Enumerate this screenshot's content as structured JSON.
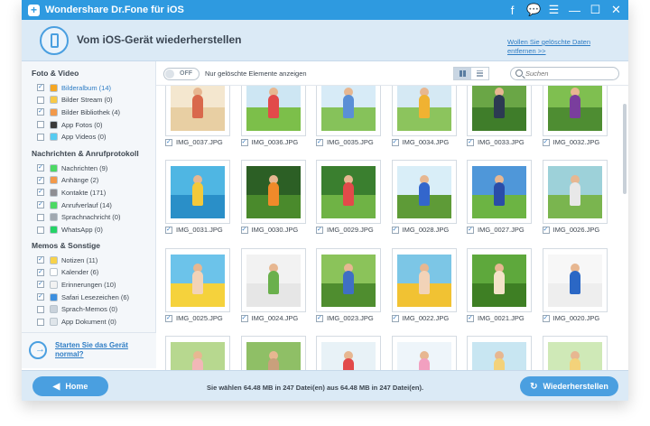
{
  "window": {
    "title": "Wondershare Dr.Fone für iOS",
    "controls": [
      "f",
      "💬",
      "☰",
      "—",
      "☐",
      "✕"
    ]
  },
  "header": {
    "title": "Vom iOS-Gerät wiederherstellen",
    "deleted_link": "Wollen Sie gelöschte Daten entfernen >>"
  },
  "sidebar": {
    "sections": [
      {
        "title": "Foto & Video",
        "items": [
          {
            "label": "Bilderalbum (14)",
            "checked": true,
            "color": "#f5a623",
            "active": true
          },
          {
            "label": "Bilder Stream (0)",
            "checked": false,
            "color": "#f7c948"
          },
          {
            "label": "Bilder Bibliothek (4)",
            "checked": true,
            "color": "#f2994a"
          },
          {
            "label": "App Fotos (0)",
            "checked": false,
            "color": "#3a3a3a"
          },
          {
            "label": "App Videos (0)",
            "checked": false,
            "color": "#56ccf2"
          }
        ]
      },
      {
        "title": "Nachrichten & Anrufprotokoll",
        "items": [
          {
            "label": "Nachrichten (9)",
            "checked": true,
            "color": "#4cd964"
          },
          {
            "label": "Anhänge (2)",
            "checked": true,
            "color": "#f2994a"
          },
          {
            "label": "Kontakte (171)",
            "checked": true,
            "color": "#8e8e93"
          },
          {
            "label": "Anrufverlauf (14)",
            "checked": true,
            "color": "#4cd964"
          },
          {
            "label": "Sprachnachricht (0)",
            "checked": false,
            "color": "#a0a8b0"
          },
          {
            "label": "WhatsApp (0)",
            "checked": false,
            "color": "#25d366"
          }
        ]
      },
      {
        "title": "Memos & Sonstige",
        "items": [
          {
            "label": "Notizen (11)",
            "checked": true,
            "color": "#f7d24a"
          },
          {
            "label": "Kalender (6)",
            "checked": true,
            "color": "#ffffff"
          },
          {
            "label": "Erinnerungen (10)",
            "checked": true,
            "color": "#f2f2f2"
          },
          {
            "label": "Safari Lesezeichen (6)",
            "checked": true,
            "color": "#3b8fe0"
          },
          {
            "label": "Sprach-Memos (0)",
            "checked": false,
            "color": "#c9d2db"
          },
          {
            "label": "App Dokument (0)",
            "checked": false,
            "color": "#dfe5ea"
          }
        ]
      }
    ],
    "help_link": "Starten Sie das Gerät normal?"
  },
  "toolbar": {
    "toggle_value": "OFF",
    "toggle_label": "Nur gelöschte Elemente anzeigen",
    "search_placeholder": "Suchen"
  },
  "photos": [
    {
      "name": "IMG_0037.JPG",
      "sky": "#f4e7cf",
      "ground": "#e8cfa3",
      "kid": "#d9694c"
    },
    {
      "name": "IMG_0036.JPG",
      "sky": "#cde6f3",
      "ground": "#7cbf4a",
      "kid": "#e24a4a"
    },
    {
      "name": "IMG_0035.JPG",
      "sky": "#d7ebf7",
      "ground": "#86c25a",
      "kid": "#5a8fd6"
    },
    {
      "name": "IMG_0034.JPG",
      "sky": "#d5e9f4",
      "ground": "#8cc45d",
      "kid": "#f0b232"
    },
    {
      "name": "IMG_0033.JPG",
      "sky": "#6aa646",
      "ground": "#3f7d2a",
      "kid": "#2c3a52"
    },
    {
      "name": "IMG_0032.JPG",
      "sky": "#7fbf50",
      "ground": "#4e8d32",
      "kid": "#7a3e9d"
    },
    {
      "name": "IMG_0031.JPG",
      "sky": "#4fb6e3",
      "ground": "#2a8fc8",
      "kid": "#f3c93b"
    },
    {
      "name": "IMG_0030.JPG",
      "sky": "#2c5f25",
      "ground": "#4a8a2c",
      "kid": "#f08a2a"
    },
    {
      "name": "IMG_0029.JPG",
      "sky": "#3a7f2f",
      "ground": "#6fb345",
      "kid": "#e24a4a"
    },
    {
      "name": "IMG_0028.JPG",
      "sky": "#d9eef8",
      "ground": "#5e9b37",
      "kid": "#3366cc"
    },
    {
      "name": "IMG_0027.JPG",
      "sky": "#4f97d9",
      "ground": "#6cb443",
      "kid": "#2a4da8"
    },
    {
      "name": "IMG_0026.JPG",
      "sky": "#9dd1d9",
      "ground": "#7ab54f",
      "kid": "#e8e8e8"
    },
    {
      "name": "IMG_0025.JPG",
      "sky": "#6cc3ea",
      "ground": "#f5d23c",
      "kid": "#f2d3b8"
    },
    {
      "name": "IMG_0024.JPG",
      "sky": "#f2f2f2",
      "ground": "#e6e6e6",
      "kid": "#6ab04c"
    },
    {
      "name": "IMG_0023.JPG",
      "sky": "#8bc35a",
      "ground": "#4f8d2f",
      "kid": "#3f6fc4"
    },
    {
      "name": "IMG_0022.JPG",
      "sky": "#7cc6e6",
      "ground": "#f1c233",
      "kid": "#f2d3b8"
    },
    {
      "name": "IMG_0021.JPG",
      "sky": "#5ea83c",
      "ground": "#3e7f24",
      "kid": "#f3e3c8"
    },
    {
      "name": "IMG_0020.JPG",
      "sky": "#f7f7f7",
      "ground": "#eeeeee",
      "kid": "#2b67c5"
    },
    {
      "name": "",
      "sky": "#b7d88f",
      "ground": "#7fb153",
      "kid": "#f2b7b7"
    },
    {
      "name": "",
      "sky": "#8fbf66",
      "ground": "#5b8f3a",
      "kid": "#c9a07c"
    },
    {
      "name": "",
      "sky": "#e8f2f7",
      "ground": "#d8e6ee",
      "kid": "#e24a4a"
    },
    {
      "name": "",
      "sky": "#eef5fa",
      "ground": "#a9d27a",
      "kid": "#f2a0c0"
    },
    {
      "name": "",
      "sky": "#c8e6f2",
      "ground": "#7cbf4a",
      "kid": "#f3d27a"
    },
    {
      "name": "",
      "sky": "#cfe9b7",
      "ground": "#8bc35a",
      "kid": "#f3d27a"
    }
  ],
  "footer": {
    "home_label": "Home",
    "status": "Sie wählen 64.48 MB in 247 Datei(en) aus 64.48 MB in 247 Datei(en).",
    "recover_label": "Wiederherstellen"
  }
}
